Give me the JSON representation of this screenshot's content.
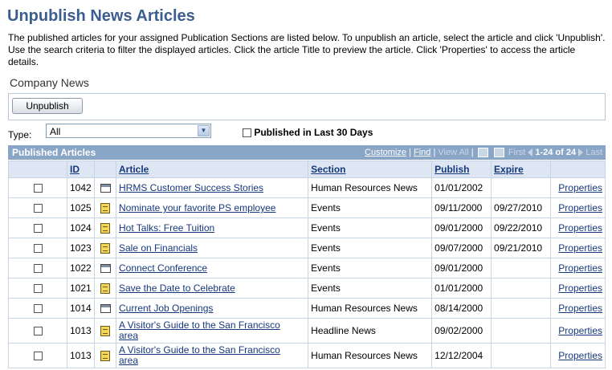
{
  "page": {
    "title": "Unpublish News Articles",
    "description": "The published articles for your assigned Publication Sections are listed below.  To unpublish an article, select the article and click 'Unpublish'. Use the search criteria to filter the displayed articles.  Click the article Title to preview the article.  Click 'Properties' to access the article details.",
    "section_title": "Company News",
    "unpublish_label": "Unpublish"
  },
  "filters": {
    "type_label": "Type:",
    "type_value": "All",
    "published_30_label": "Published in Last 30 Days"
  },
  "grid": {
    "title": "Published Articles",
    "customize": "Customize",
    "separator": "|",
    "find": "Find",
    "view_all": "View All",
    "first": "First",
    "range": "1-24 of 24",
    "last": "Last",
    "columns": [
      "ID",
      "Article",
      "Section",
      "Publish",
      "Expire"
    ],
    "rows": [
      {
        "id": "1042",
        "icon": "news-icon",
        "article": "HRMS Customer Success Stories",
        "section": "Human Resources News",
        "publish": "01/01/2002",
        "expire": "",
        "props": "Properties"
      },
      {
        "id": "1025",
        "icon": "note-icon",
        "article": "Nominate your favorite PS employee",
        "section": "Events",
        "publish": "09/11/2000",
        "expire": "09/27/2010",
        "props": "Properties"
      },
      {
        "id": "1024",
        "icon": "note-icon",
        "article": "Hot Talks: Free Tuition",
        "section": "Events",
        "publish": "09/01/2000",
        "expire": "09/22/2010",
        "props": "Properties"
      },
      {
        "id": "1023",
        "icon": "note-icon",
        "article": "Sale on Financials",
        "section": "Events",
        "publish": "09/07/2000",
        "expire": "09/21/2010",
        "props": "Properties"
      },
      {
        "id": "1022",
        "icon": "news-icon",
        "article": "Connect Conference",
        "section": "Events",
        "publish": "09/01/2000",
        "expire": "",
        "props": "Properties"
      },
      {
        "id": "1021",
        "icon": "note-icon",
        "article": "Save the Date to Celebrate",
        "section": "Events",
        "publish": "01/01/2000",
        "expire": "",
        "props": "Properties"
      },
      {
        "id": "1014",
        "icon": "news-icon",
        "article": "Current Job Openings",
        "section": "Human Resources News",
        "publish": "08/14/2000",
        "expire": "",
        "props": "Properties"
      },
      {
        "id": "1013",
        "icon": "note-icon",
        "article": "A Visitor's Guide to the San Francisco area",
        "section": "Headline News",
        "publish": "09/02/2000",
        "expire": "",
        "props": "Properties"
      },
      {
        "id": "1013",
        "icon": "note-icon",
        "article": "A Visitor's Guide to the San Francisco area",
        "section": "Human Resources News",
        "publish": "12/12/2004",
        "expire": "",
        "props": "Properties"
      }
    ]
  }
}
